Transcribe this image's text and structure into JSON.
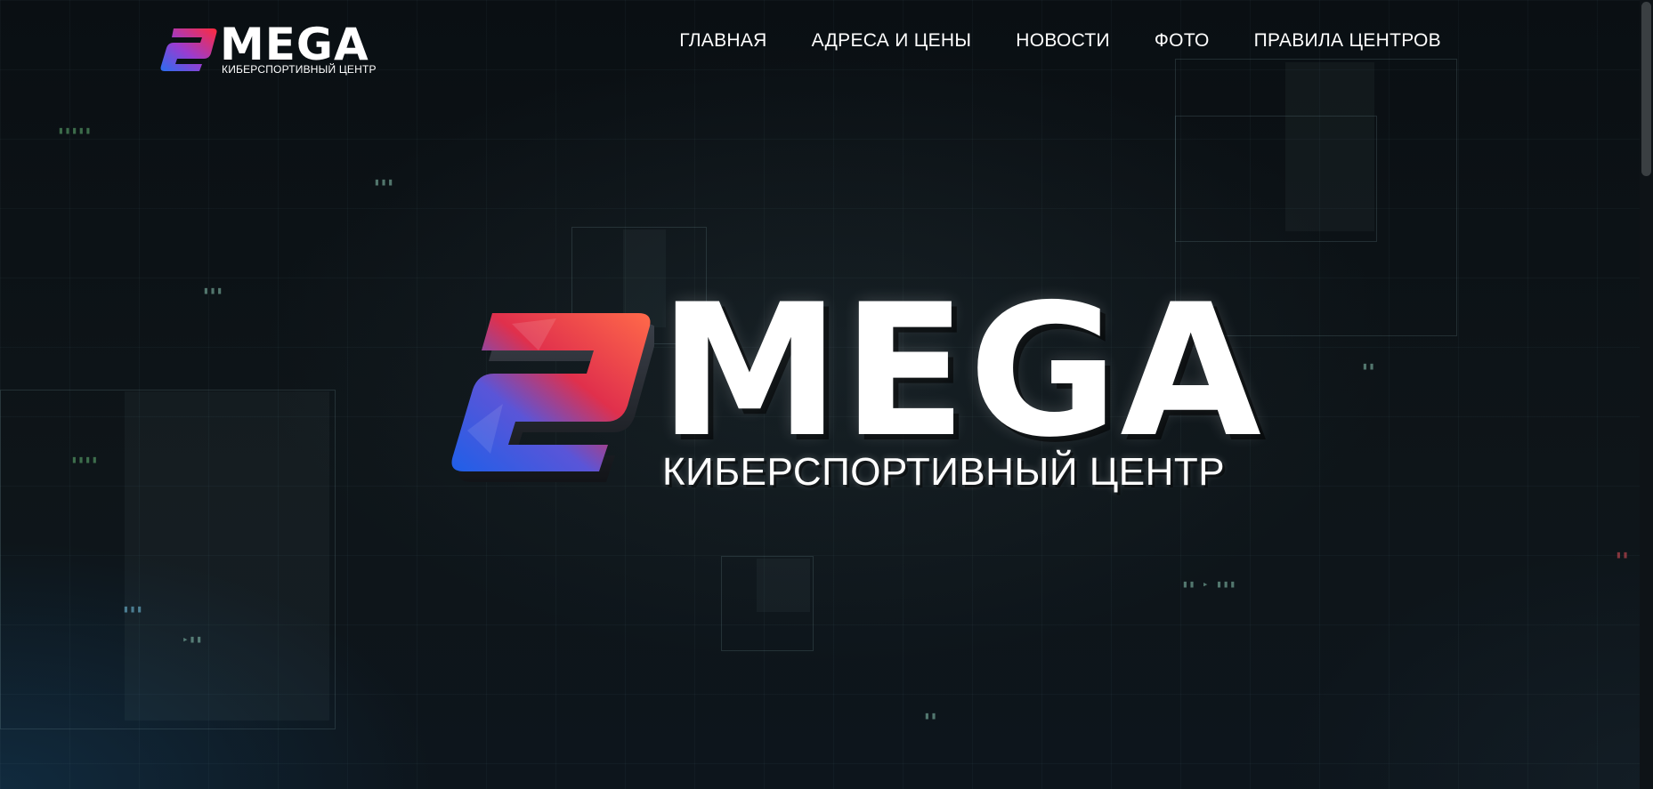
{
  "header": {
    "logo": {
      "word": "MEGA",
      "subtitle": "КИБЕРСПОРТИВНЫЙ ЦЕНТР"
    },
    "nav": [
      {
        "label": "ГЛАВНАЯ"
      },
      {
        "label": "АДРЕСА И ЦЕНЫ"
      },
      {
        "label": "НОВОСТИ"
      },
      {
        "label": "ФОТО"
      },
      {
        "label": "ПРАВИЛА ЦЕНТРОВ"
      }
    ]
  },
  "hero": {
    "word": "MEGA",
    "subtitle": "КИБЕРСПОРТИВНЫЙ ЦЕНТР"
  },
  "colors": {
    "background": "#0b1014",
    "text": "#ffffff",
    "logo_red": "#e8283a",
    "logo_blue": "#2a6ef0"
  },
  "icons": {
    "logo_mark": "mega-logo-icon"
  }
}
